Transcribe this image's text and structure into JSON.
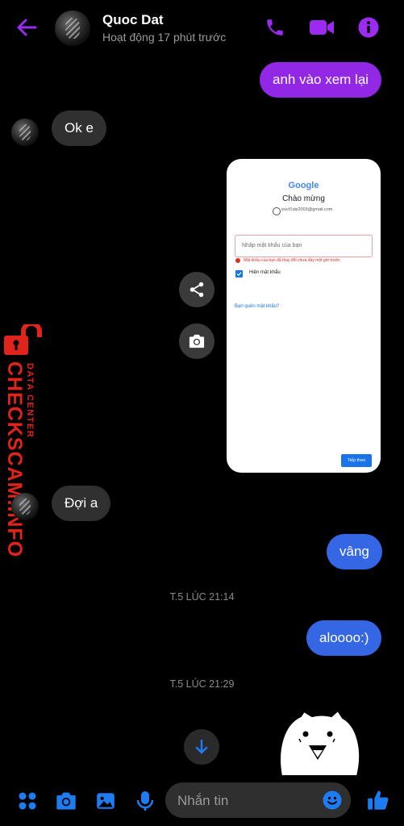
{
  "header": {
    "contact_name": "Quoc Dat",
    "status": "Hoạt động 17 phút trước",
    "icons": [
      "back-arrow-icon",
      "phone-icon",
      "video-call-icon",
      "info-icon"
    ]
  },
  "messages": [
    {
      "side": "out",
      "text": "anh vào xem lại"
    },
    {
      "side": "in",
      "text": "Ok e"
    },
    {
      "side": "out",
      "type": "image"
    },
    {
      "side": "in",
      "text": "Đợi a"
    },
    {
      "side": "out",
      "text": "vâng"
    },
    {
      "timestamp": "T.5 LÚC 21:14"
    },
    {
      "side": "out",
      "text": "aloooo:)"
    },
    {
      "timestamp": "T.5 LÚC 21:29"
    }
  ],
  "screenshot": {
    "logo": "Google",
    "heading": "Chào mừng",
    "email": "eucf1vip2003@gmail.com",
    "password_placeholder": "Nhập mật khẩu của bạn",
    "error_text": "Mật khẩu của bạn đã thay đổi chưa đầy một giờ trước",
    "show_password": "Hiện mật khẩu",
    "forgot_link": "Bạn quên mật khẩu?",
    "next_button": "Tiếp theo"
  },
  "watermark": {
    "line1": "DATA CENTER",
    "line2": "CHECKSCAM.INFO"
  },
  "composer": {
    "placeholder": "Nhắn tin",
    "icons": [
      "apps-icon",
      "camera-icon",
      "gallery-icon",
      "microphone-icon",
      "emoji-icon",
      "thumbs-up-icon"
    ]
  },
  "colors": {
    "accent_purple": "#9227e6",
    "accent_blue": "#3566e4",
    "incoming_bubble": "#303030",
    "composer_icon_blue": "#1e7cf2",
    "header_icon_purple": "#9b2bf0",
    "watermark_red": "#e0241c"
  }
}
